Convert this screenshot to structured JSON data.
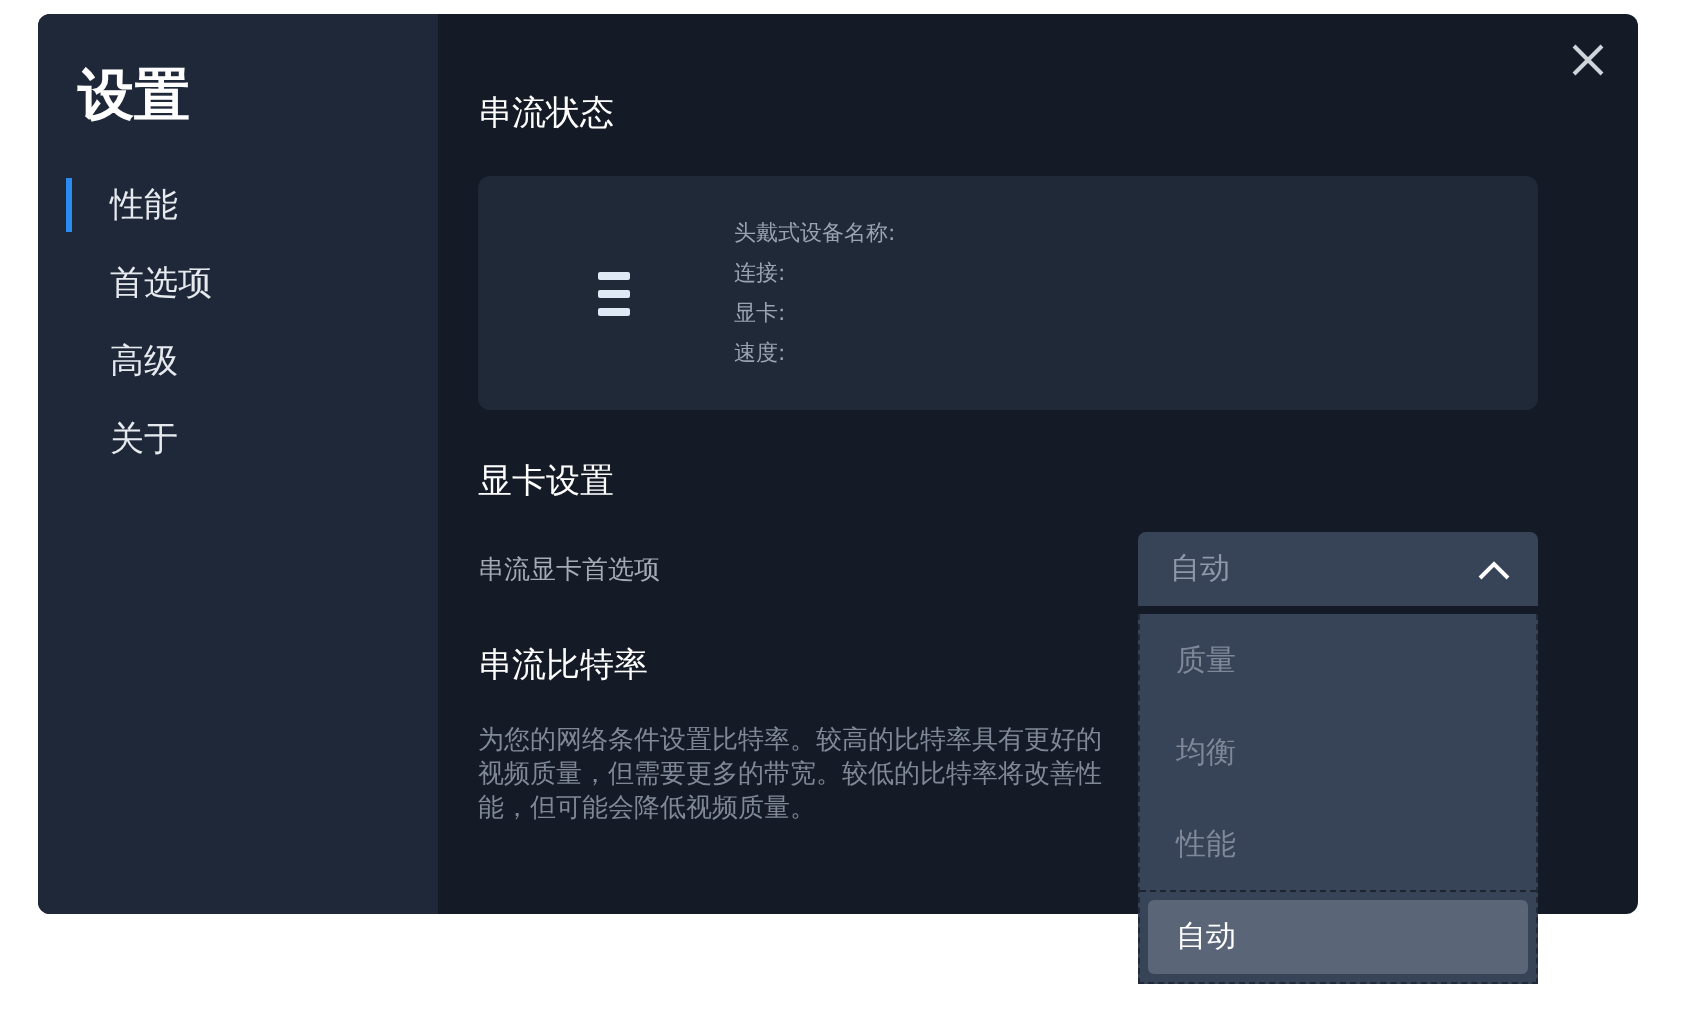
{
  "window": {
    "title": "设置"
  },
  "sidebar": {
    "items": [
      {
        "label": "性能",
        "selected": true
      },
      {
        "label": "首选项",
        "selected": false
      },
      {
        "label": "高级",
        "selected": false
      },
      {
        "label": "关于",
        "selected": false
      }
    ]
  },
  "stream_status": {
    "heading": "串流状态",
    "fields": [
      "头戴式设备名称:",
      "连接:",
      "显卡:",
      "速度:"
    ]
  },
  "gpu_settings": {
    "heading": "显卡设置",
    "label": "串流显卡首选项",
    "value": "自动",
    "expanded": true,
    "options": [
      {
        "label": "质量",
        "selected": false
      },
      {
        "label": "均衡",
        "selected": false
      },
      {
        "label": "性能",
        "selected": false
      },
      {
        "label": "自动",
        "selected": true
      }
    ]
  },
  "bitrate": {
    "heading": "串流比特率",
    "description": "为您的网络条件设置比特率。较高的比特率具有更好的视频质量，但需要更多的带宽。较低的比特率将改善性能，但可能会降低视频质量。"
  }
}
